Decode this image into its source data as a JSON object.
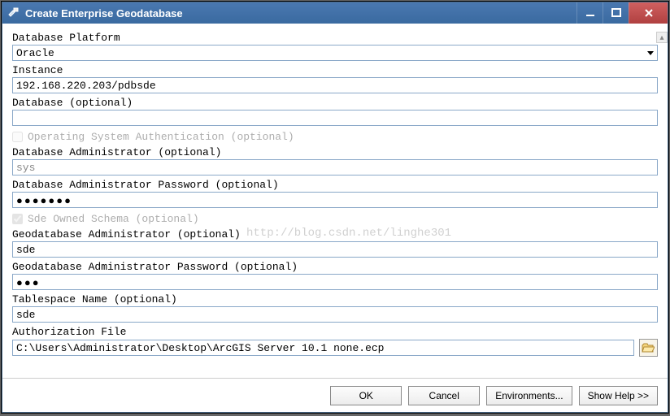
{
  "window": {
    "title": "Create Enterprise Geodatabase"
  },
  "fields": {
    "platform_label": "Database Platform",
    "platform_value": "Oracle",
    "instance_label": "Instance",
    "instance_value": "192.168.220.203/pdbsde",
    "database_label": "Database (optional)",
    "database_value": "",
    "osauth_label": "Operating System Authentication (optional)",
    "dbadmin_label": "Database Administrator (optional)",
    "dbadmin_value": "sys",
    "dbadminpw_label": "Database Administrator Password (optional)",
    "dbadminpw_value": "●●●●●●●",
    "sdeowned_label": "Sde Owned Schema (optional)",
    "geoadmin_label": "Geodatabase Administrator (optional)",
    "geoadmin_value": "sde",
    "geoadminpw_label": "Geodatabase Administrator Password (optional)",
    "geoadminpw_value": "●●●",
    "tablespace_label": "Tablespace Name (optional)",
    "tablespace_value": "sde",
    "authfile_label": "Authorization File",
    "authfile_value": "C:\\Users\\Administrator\\Desktop\\ArcGIS Server 10.1 none.ecp"
  },
  "footer": {
    "ok": "OK",
    "cancel": "Cancel",
    "environments": "Environments...",
    "showhelp": "Show Help >>"
  },
  "watermark": "http://blog.csdn.net/linghe301"
}
